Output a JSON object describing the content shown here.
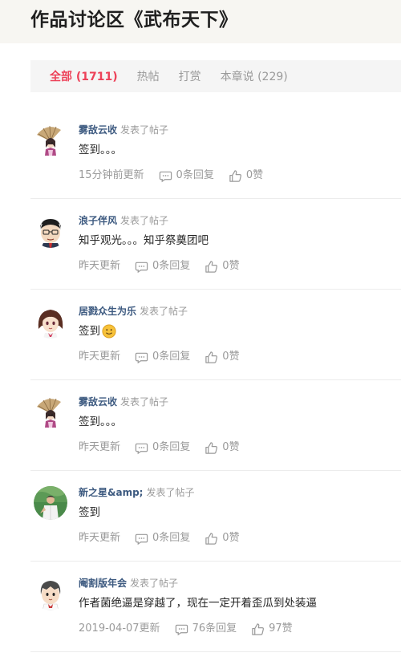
{
  "header": {
    "title": "作品讨论区《武布天下》"
  },
  "tabs": [
    {
      "label": "全部 (1711)"
    },
    {
      "label": "热帖"
    },
    {
      "label": "打赏"
    },
    {
      "label": "本章说 (229)"
    }
  ],
  "posts": [
    {
      "author": "雾敌云收",
      "action": "发表了帖子",
      "content": "签到。。。",
      "time": "15分钟前更新",
      "replies": "0条回复",
      "likes": "0赞",
      "avatar": "girl-umbrella"
    },
    {
      "author": "浪子伴风",
      "action": "发表了帖子",
      "content": "知乎观光。。。知乎祭奠团吧",
      "time": "昨天更新",
      "replies": "0条回复",
      "likes": "0赞",
      "avatar": "boy-glasses"
    },
    {
      "author": "居戮众生为乐",
      "action": "发表了帖子",
      "content": "签到",
      "time": "昨天更新",
      "replies": "0条回复",
      "likes": "0赞",
      "avatar": "girl-brown-hair",
      "emoji": "smile"
    },
    {
      "author": "雾敌云收",
      "action": "发表了帖子",
      "content": "签到。。。",
      "time": "昨天更新",
      "replies": "0条回复",
      "likes": "0赞",
      "avatar": "girl-umbrella"
    },
    {
      "author": "新之星&amp;",
      "action": "发表了帖子",
      "content": "签到",
      "time": "昨天更新",
      "replies": "0条回复",
      "likes": "0赞",
      "avatar": "photo"
    },
    {
      "author": "阉割版年会",
      "action": "发表了帖子",
      "content": "作者菌绝逼是穿越了，现在一定开着歪瓜到处装逼",
      "time": "2019-04-07更新",
      "replies": "76条回复",
      "likes": "97赞",
      "avatar": "boy-cartoon"
    }
  ]
}
